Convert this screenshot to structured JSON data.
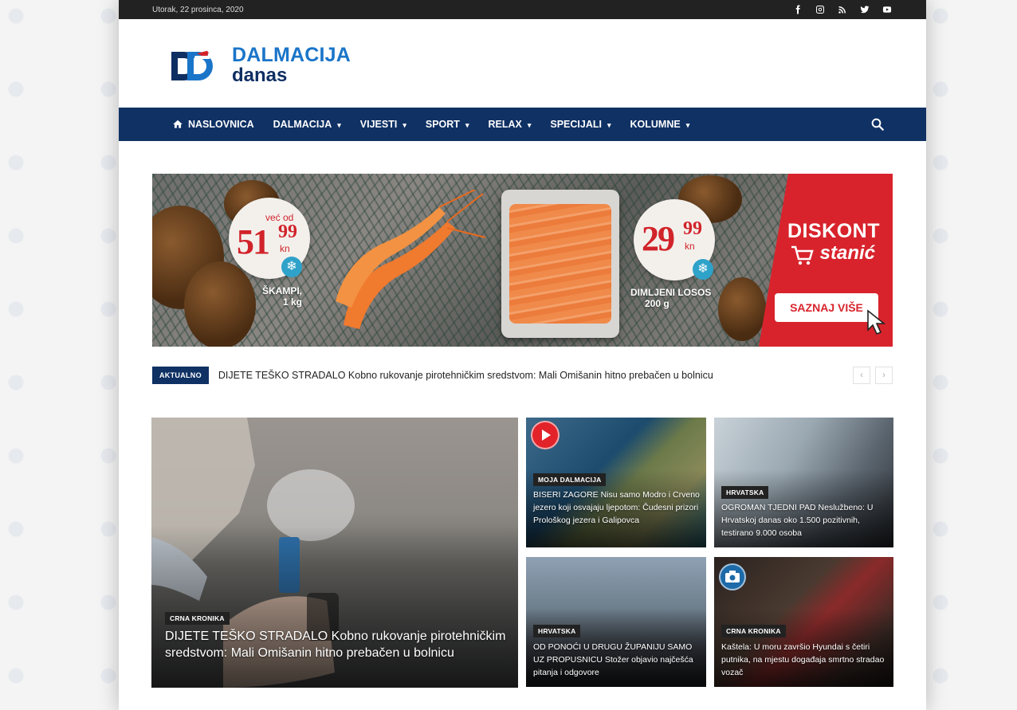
{
  "topbar": {
    "date": "Utorak, 22 prosinca, 2020",
    "social": [
      "facebook-icon",
      "instagram-icon",
      "rss-icon",
      "twitter-icon",
      "youtube-icon"
    ]
  },
  "logo": {
    "line1": "DALMACIJA",
    "line2": "danas",
    "mark": "D"
  },
  "nav": {
    "items": [
      {
        "label": "NASLOVNICA",
        "dropdown": false
      },
      {
        "label": "DALMACIJA",
        "dropdown": true
      },
      {
        "label": "VIJESTI",
        "dropdown": true
      },
      {
        "label": "SPORT",
        "dropdown": true
      },
      {
        "label": "RELAX",
        "dropdown": true
      },
      {
        "label": "SPECIJALI",
        "dropdown": true
      },
      {
        "label": "KOLUMNE",
        "dropdown": true
      }
    ],
    "chevron": "▾"
  },
  "banner": {
    "price1_from": "već od",
    "price1_main": "51",
    "price1_cents": "99",
    "price1_unit": "kn",
    "product1_line1": "ŠKAMPI,",
    "product1_line2": "1 kg",
    "price2_main": "29",
    "price2_cents": "99",
    "price2_unit": "kn",
    "product2_line1": "DIMLJENI LOSOS",
    "product2_line2": "200 g",
    "brand1": "DISKONT",
    "brand2": "stanić",
    "cta": "SAZNAJ VIŠE",
    "colors": {
      "brand_red": "#d8232c",
      "snow_blue": "#2fa2c9"
    }
  },
  "ticker": {
    "badge": "AKTUALNO",
    "text": "DIJETE TEŠKO STRADALO Kobno rukovanje pirotehničkim sredstvom: Mali Omišanin hitno prebačen u bolnicu",
    "prev": "‹",
    "next": "›"
  },
  "cards": {
    "main": {
      "category": "CRNA KRONIKA",
      "title": "DIJETE TEŠKO STRADALO Kobno rukovanje pirotehničkim sredstvom: Mali Omišanin hitno prebačen u bolnicu"
    },
    "zagore": {
      "category": "MOJA DALMACIJA",
      "title": "BISERI ZAGORE Nisu samo Modro i Crveno jezero koji osvajaju ljepotom: Čudesni prizori Prološkog jezera i Galipovca"
    },
    "hrv1": {
      "category": "HRVATSKA",
      "title": "OGROMAN TJEDNI PAD Neslužbeno: U Hrvatskoj danas oko 1.500 pozitivnih, testirano 9.000 osoba"
    },
    "hrv2": {
      "category": "HRVATSKA",
      "title": "OD PONOĆI U DRUGU ŽUPANIJU SAMO UZ PROPUSNICU Stožer objavio najčešća pitanja i odgovore"
    },
    "kastela": {
      "category": "CRNA KRONIKA",
      "title": "Kaštela: U moru završio Hyundai s četiri putnika, na mjestu događaja smrtno stradao vozač"
    }
  },
  "colors": {
    "nav_bg": "#0f3164",
    "topbar_bg": "#222222",
    "logo_blue": "#1a75c9",
    "logo_navy": "#0f2f63"
  }
}
